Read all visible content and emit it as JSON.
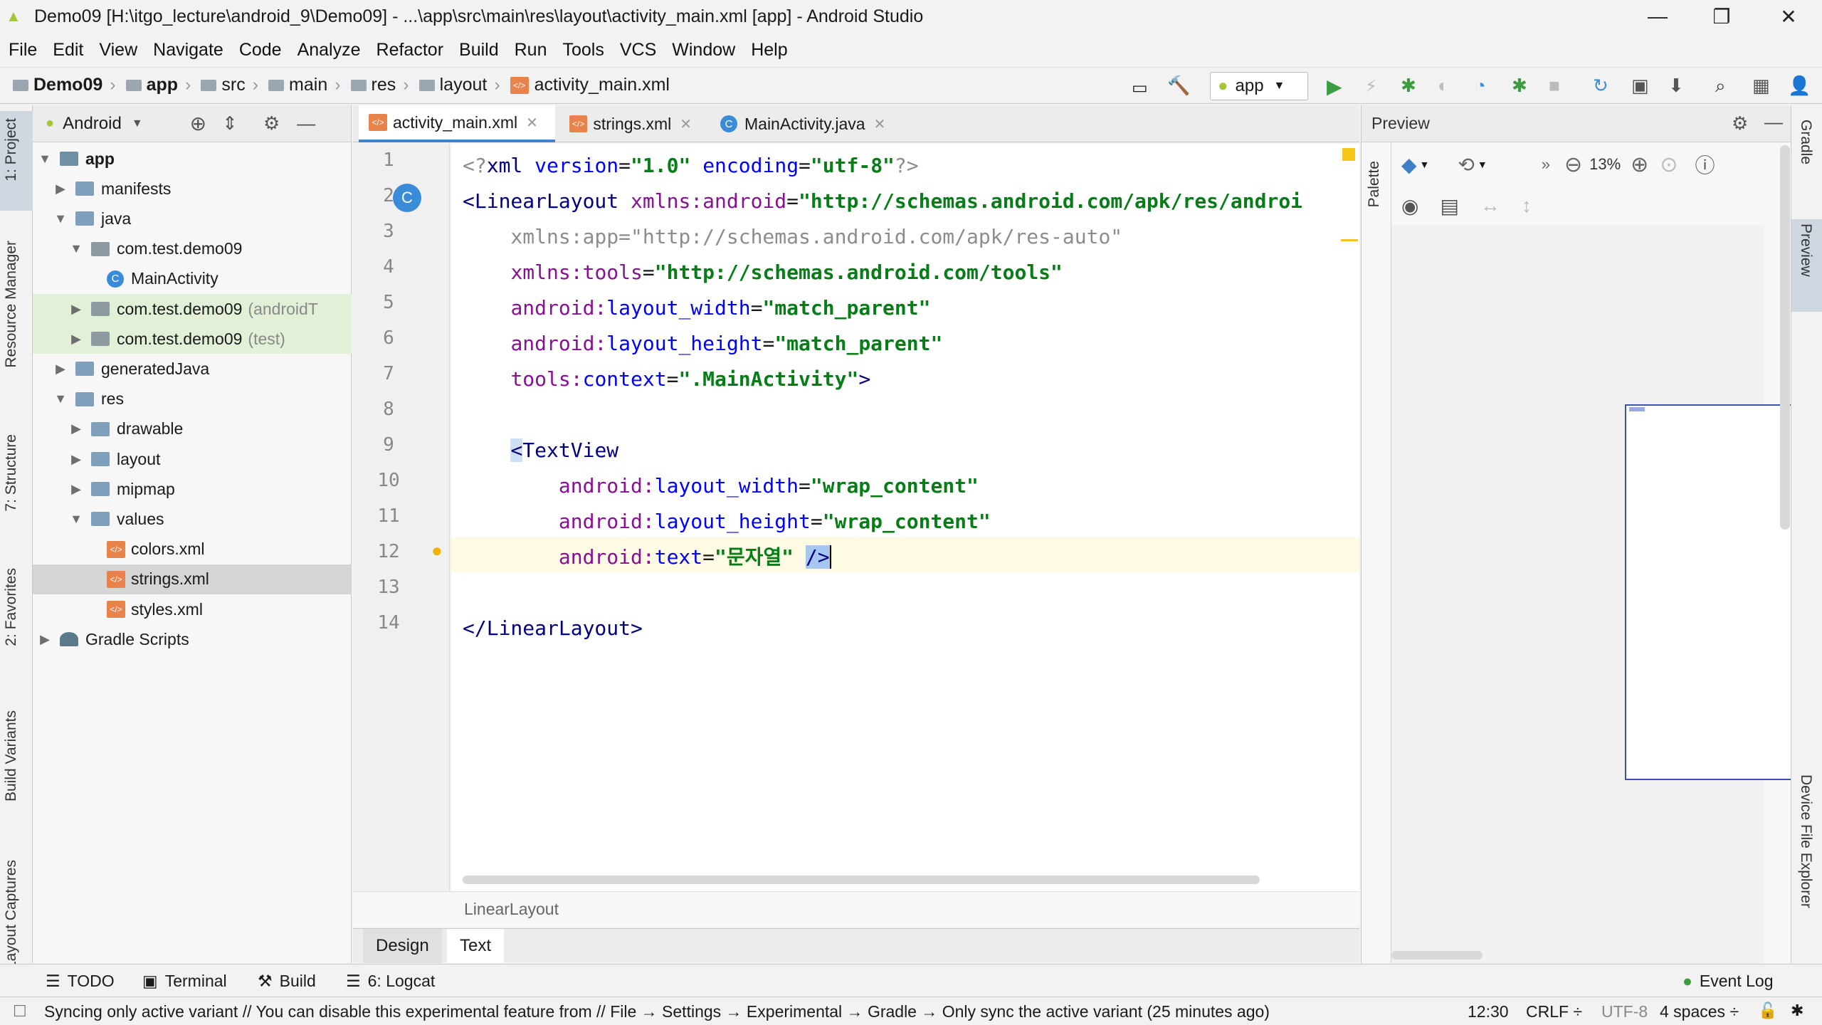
{
  "window": {
    "title": "Demo09 [H:\\itgo_lecture\\android_9\\Demo09] - ...\\app\\src\\main\\res\\layout\\activity_main.xml [app] - Android Studio",
    "minimize": "—",
    "maximize": "❐",
    "close": "✕"
  },
  "menu": [
    "File",
    "Edit",
    "View",
    "Navigate",
    "Code",
    "Analyze",
    "Refactor",
    "Build",
    "Run",
    "Tools",
    "VCS",
    "Window",
    "Help"
  ],
  "breadcrumb": [
    "Demo09",
    "app",
    "src",
    "main",
    "res",
    "layout",
    "activity_main.xml"
  ],
  "run_config": "app",
  "project_panel": {
    "view": "Android",
    "tree": [
      {
        "label": "app",
        "depth": 0,
        "state": "open",
        "icon": "module",
        "bold": true
      },
      {
        "label": "manifests",
        "depth": 1,
        "state": "closed",
        "icon": "folder"
      },
      {
        "label": "java",
        "depth": 1,
        "state": "open",
        "icon": "folder"
      },
      {
        "label": "com.test.demo09",
        "depth": 2,
        "state": "open",
        "icon": "package"
      },
      {
        "label": "MainActivity",
        "depth": 3,
        "state": "none",
        "icon": "class"
      },
      {
        "label": "com.test.demo09",
        "suffix": "(androidT",
        "depth": 2,
        "state": "closed",
        "icon": "package",
        "green": true
      },
      {
        "label": "com.test.demo09",
        "suffix": "(test)",
        "depth": 2,
        "state": "closed",
        "icon": "package",
        "green": true
      },
      {
        "label": "generatedJava",
        "depth": 1,
        "state": "closed",
        "icon": "folder"
      },
      {
        "label": "res",
        "depth": 1,
        "state": "open",
        "icon": "folder"
      },
      {
        "label": "drawable",
        "depth": 2,
        "state": "closed",
        "icon": "folder"
      },
      {
        "label": "layout",
        "depth": 2,
        "state": "closed",
        "icon": "folder"
      },
      {
        "label": "mipmap",
        "depth": 2,
        "state": "closed",
        "icon": "folder"
      },
      {
        "label": "values",
        "depth": 2,
        "state": "open",
        "icon": "folder"
      },
      {
        "label": "colors.xml",
        "depth": 3,
        "state": "none",
        "icon": "xml"
      },
      {
        "label": "strings.xml",
        "depth": 3,
        "state": "none",
        "icon": "xml",
        "selected": true
      },
      {
        "label": "styles.xml",
        "depth": 3,
        "state": "none",
        "icon": "xml"
      },
      {
        "label": "Gradle Scripts",
        "depth": 0,
        "state": "closed",
        "icon": "gradle"
      }
    ]
  },
  "left_tool_tabs": [
    "1: Project",
    "Resource Manager",
    "7: Structure",
    "2: Favorites",
    "Build Variants",
    "Layout Captures"
  ],
  "right_tool_tabs": [
    "Gradle",
    "Preview",
    "Device File Explorer"
  ],
  "editor_tabs": [
    {
      "label": "activity_main.xml",
      "active": true
    },
    {
      "label": "strings.xml",
      "active": false
    },
    {
      "label": "MainActivity.java",
      "active": false
    }
  ],
  "code_lines": [
    "<?xml version=\"1.0\" encoding=\"utf-8\"?>",
    "<LinearLayout xmlns:android=\"http://schemas.android.com/apk/res/androi",
    "    xmlns:app=\"http://schemas.android.com/apk/res-auto\"",
    "    xmlns:tools=\"http://schemas.android.com/tools\"",
    "    android:layout_width=\"match_parent\"",
    "    android:layout_height=\"match_parent\"",
    "    tools:context=\".MainActivity\">",
    "",
    "    <TextView",
    "        android:layout_width=\"wrap_content\"",
    "        android:layout_height=\"wrap_content\"",
    "        android:text=\"문자열\" />",
    "",
    "</LinearLayout>"
  ],
  "line_numbers": [
    "1",
    "2",
    "3",
    "4",
    "5",
    "6",
    "7",
    "8",
    "9",
    "10",
    "11",
    "12",
    "13",
    "14"
  ],
  "editor_breadcrumb": "LinearLayout",
  "design_tabs": [
    "Design",
    "Text"
  ],
  "preview": {
    "title": "Preview",
    "zoom": "13%",
    "palette": "Palette"
  },
  "tool_windows": [
    "TODO",
    "Terminal",
    "Build",
    "6: Logcat"
  ],
  "event_log": "Event Log",
  "status": {
    "message": "Syncing only active variant // You can disable this experimental feature from // File → Settings → Experimental → Gradle → Only sync the active variant (25 minutes ago)",
    "position": "12:30",
    "line_sep": "CRLF ÷",
    "encoding": "UTF-8",
    "indent": "4 spaces ÷"
  },
  "colors": {
    "accent": "#4083c9",
    "android_green": "#a4c639",
    "orange_xml": "#e8834b",
    "current_line": "#fffae3"
  }
}
